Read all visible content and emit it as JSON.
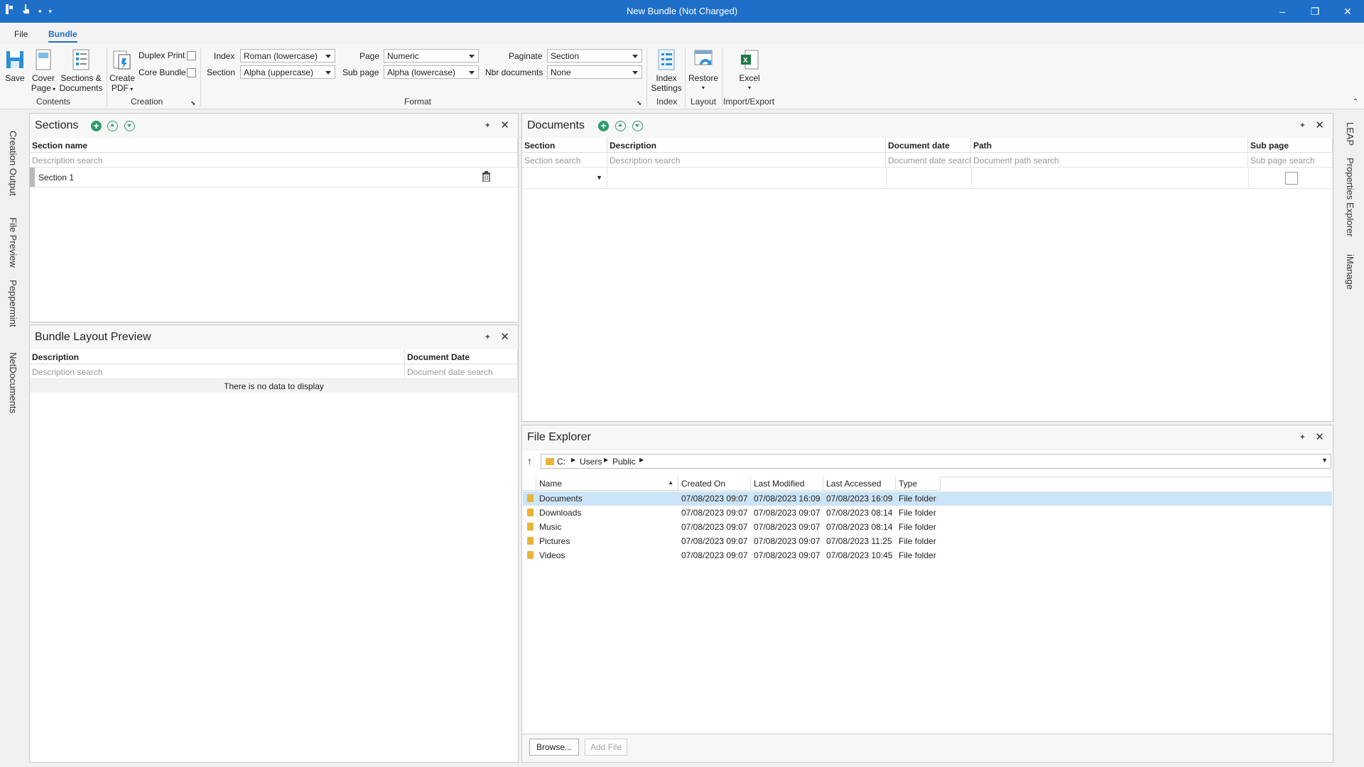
{
  "window": {
    "title": "New Bundle (Not Charged)",
    "controls": [
      "–",
      "❐",
      "✕"
    ]
  },
  "ribbon_tabs": [
    "File",
    "Bundle"
  ],
  "ribbon": {
    "save": "Save",
    "cover_page": [
      "Cover",
      "Page"
    ],
    "sections_documents": [
      "Sections &",
      "Documents"
    ],
    "create_pdf": [
      "Create",
      "PDF"
    ],
    "duplex_print": "Duplex Print",
    "core_bundle": "Core Bundle",
    "index_label": "Index",
    "index_value": "Roman (lowercase)",
    "section_label": "Section",
    "section_value": "Alpha (uppercase)",
    "page_label": "Page",
    "page_value": "Numeric",
    "subpage_label": "Sub page",
    "subpage_value": "Alpha (lowercase)",
    "paginate_label": "Paginate",
    "paginate_value": "Section",
    "nbr_docs_label": "Nbr documents",
    "nbr_docs_value": "None",
    "index_settings": [
      "Index",
      "Settings"
    ],
    "restore": "Restore",
    "excel": "Excel",
    "groups": {
      "contents": "Contents",
      "creation": "Creation",
      "format": "Format",
      "index": "Index",
      "layout": "Layout",
      "import_export": "Import/Export"
    }
  },
  "left_tabs": [
    "Creation Output",
    "File Preview",
    "Peppermint",
    "NetDocuments"
  ],
  "right_tabs": [
    "LEAP",
    "Properties Explorer",
    "iManage"
  ],
  "sections_panel": {
    "title": "Sections",
    "col_name": "Section name",
    "search_placeholder": "Description search",
    "rows": [
      "Section 1"
    ]
  },
  "documents_panel": {
    "title": "Documents",
    "columns": [
      "Section",
      "Description",
      "Document date",
      "Path",
      "Sub page"
    ],
    "search": [
      "Section search",
      "Description search",
      "Document date search",
      "Document path search",
      "Sub page search"
    ]
  },
  "layout_panel": {
    "title": "Bundle Layout Preview",
    "columns": [
      "Description",
      "Document Date"
    ],
    "search": [
      "Description search",
      "Document date search"
    ],
    "empty_text": "There is no data to display"
  },
  "file_explorer": {
    "title": "File Explorer",
    "path": [
      "C:",
      "Users",
      "Public"
    ],
    "columns": [
      "Name",
      "Created On",
      "Last Modified",
      "Last Accessed",
      "Type"
    ],
    "rows": [
      [
        "Documents",
        "07/08/2023 09:07",
        "07/08/2023 16:09",
        "07/08/2023 16:09",
        "File folder"
      ],
      [
        "Downloads",
        "07/08/2023 09:07",
        "07/08/2023 09:07",
        "07/08/2023 08:14",
        "File folder"
      ],
      [
        "Music",
        "07/08/2023 09:07",
        "07/08/2023 09:07",
        "07/08/2023 08:14",
        "File folder"
      ],
      [
        "Pictures",
        "07/08/2023 09:07",
        "07/08/2023 09:07",
        "07/08/2023 11:25",
        "File folder"
      ],
      [
        "Videos",
        "07/08/2023 09:07",
        "07/08/2023 09:07",
        "07/08/2023 10:45",
        "File folder"
      ]
    ],
    "browse": "Browse...",
    "add_file": "Add File"
  }
}
